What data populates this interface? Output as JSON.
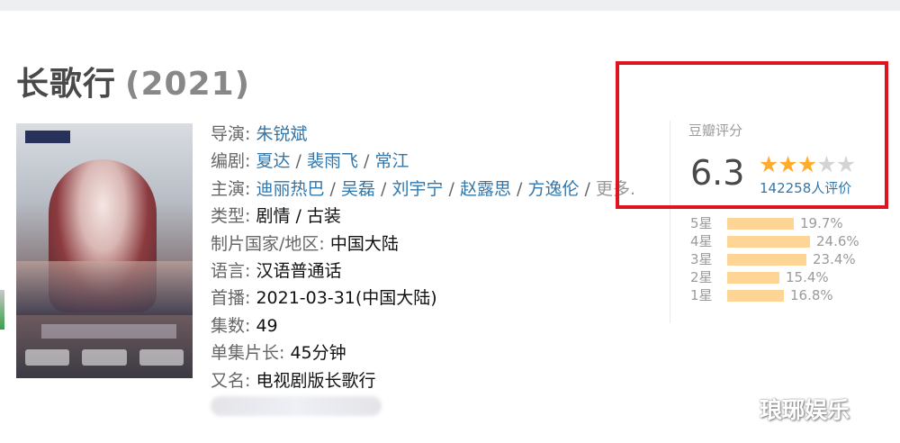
{
  "title": {
    "name": "长歌行",
    "year": "(2021)"
  },
  "info": {
    "director": {
      "label": "导演:",
      "names": [
        "朱锐斌"
      ]
    },
    "writer": {
      "label": "编剧:",
      "names": [
        "夏达",
        "裴雨飞",
        "常江"
      ]
    },
    "cast": {
      "label": "主演:",
      "names": [
        "迪丽热巴",
        "吴磊",
        "刘宇宁",
        "赵露思",
        "方逸伦"
      ],
      "more": "更多..."
    },
    "genre": {
      "label": "类型:",
      "value": "剧情 / 古装"
    },
    "country": {
      "label": "制片国家/地区:",
      "value": "中国大陆"
    },
    "language": {
      "label": "语言:",
      "value": "汉语普通话"
    },
    "premiere": {
      "label": "首播:",
      "value": "2021-03-31(中国大陆)"
    },
    "episodes": {
      "label": "集数:",
      "value": "49"
    },
    "runtime": {
      "label": "单集片长:",
      "value": "45分钟"
    },
    "aka": {
      "label": "又名:",
      "value": "电视剧版长歌行"
    }
  },
  "rating": {
    "title": "豆瓣评分",
    "score": "6.3",
    "stars_filled": 3,
    "stars_total": 5,
    "votes": "142258人评价",
    "distribution": [
      {
        "label": "5星",
        "value": 19.7,
        "pct": "19.7%"
      },
      {
        "label": "4星",
        "value": 24.6,
        "pct": "24.6%"
      },
      {
        "label": "3星",
        "value": 23.4,
        "pct": "23.4%"
      },
      {
        "label": "2星",
        "value": 15.4,
        "pct": "15.4%"
      },
      {
        "label": "1星",
        "value": 16.8,
        "pct": "16.8%"
      }
    ]
  },
  "watermark": "琅琊娱乐",
  "colors": {
    "link": "#3377aa",
    "star": "#ffac2d",
    "bar": "#ffd596",
    "highlight": "#e0141e"
  }
}
